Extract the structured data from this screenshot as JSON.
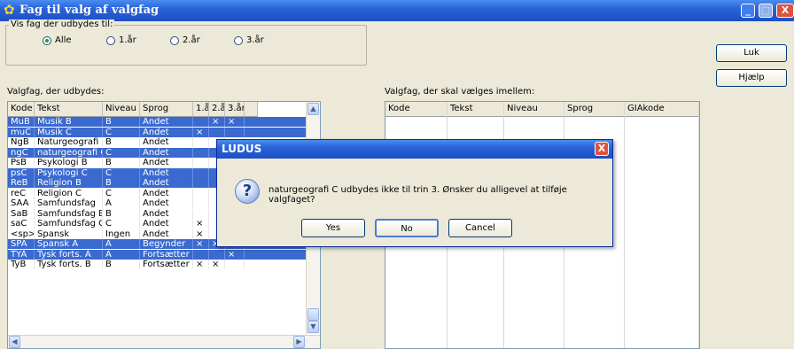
{
  "window": {
    "title": "Fag til valg af valgfag",
    "min_glyph": "_",
    "max_glyph": "□",
    "close_glyph": "X",
    "app_glyph": "✿"
  },
  "filter": {
    "title": "Vis fag der udbydes til:",
    "options": [
      {
        "label": "Alle",
        "checked": true
      },
      {
        "label": "1.år",
        "checked": false
      },
      {
        "label": "2.år",
        "checked": false
      },
      {
        "label": "3.år",
        "checked": false
      }
    ]
  },
  "left_list": {
    "label": "Valgfag, der udbydes:",
    "columns": [
      "Kode",
      "Tekst",
      "Niveau",
      "Sprog",
      "1.år",
      "2.år",
      "3.år"
    ],
    "rows": [
      {
        "cells": [
          "MuB",
          "Musik B",
          "B",
          "Andet",
          "",
          "×",
          "×"
        ],
        "selected": true
      },
      {
        "cells": [
          "muC",
          "Musik C",
          "C",
          "Andet",
          "×",
          "",
          ""
        ],
        "selected": true
      },
      {
        "cells": [
          "NgB",
          "Naturgeografi B",
          "B",
          "Andet",
          "",
          "",
          ""
        ],
        "selected": false
      },
      {
        "cells": [
          "ngC",
          "naturgeografi C",
          "C",
          "Andet",
          "",
          "",
          ""
        ],
        "selected": true
      },
      {
        "cells": [
          "PsB",
          "Psykologi B",
          "B",
          "Andet",
          "",
          "",
          ""
        ],
        "selected": false
      },
      {
        "cells": [
          "psC",
          "Psykologi C",
          "C",
          "Andet",
          "",
          "",
          ""
        ],
        "selected": true
      },
      {
        "cells": [
          "ReB",
          "Religion B",
          "B",
          "Andet",
          "",
          "",
          ""
        ],
        "selected": true
      },
      {
        "cells": [
          "reC",
          "Religion C",
          "C",
          "Andet",
          "",
          "",
          ""
        ],
        "selected": false
      },
      {
        "cells": [
          "SAA",
          "Samfundsfag",
          "A",
          "Andet",
          "",
          "",
          ""
        ],
        "selected": false
      },
      {
        "cells": [
          "SaB",
          "Samfundsfag B",
          "B",
          "Andet",
          "",
          "",
          ""
        ],
        "selected": false
      },
      {
        "cells": [
          "saC",
          "Samfundsfag C",
          "C",
          "Andet",
          "×",
          "",
          ""
        ],
        "selected": false
      },
      {
        "cells": [
          "<sp>",
          "Spansk",
          "Ingen",
          "Andet",
          "×",
          "",
          ""
        ],
        "selected": false
      },
      {
        "cells": [
          "SPA",
          "Spansk A",
          "A",
          "Begynder",
          "×",
          "×",
          "×"
        ],
        "selected": true
      },
      {
        "cells": [
          "TYA",
          "Tysk forts. A",
          "A",
          "Fortsætter",
          "",
          "",
          "×"
        ],
        "selected": true
      },
      {
        "cells": [
          "TyB",
          "Tysk forts. B",
          "B",
          "Fortsætter",
          "×",
          "×",
          ""
        ],
        "selected": false
      }
    ]
  },
  "right_list": {
    "label": "Valgfag, der skal vælges imellem:",
    "columns": [
      "Kode",
      "Tekst",
      "Niveau",
      "Sprog",
      "GIAkode"
    ]
  },
  "buttons": {
    "close": "Luk",
    "help": "Hjælp"
  },
  "scroll": {
    "up": "▲",
    "down": "▼",
    "left": "◀",
    "right": "▶"
  },
  "dialog": {
    "title": "LUDUS",
    "close_glyph": "X",
    "icon_glyph": "?",
    "message": "naturgeografi C udbydes ikke til trin 3. Ønsker du alligevel at tilføje valgfaget?",
    "buttons": [
      "Yes",
      "No",
      "Cancel"
    ]
  }
}
